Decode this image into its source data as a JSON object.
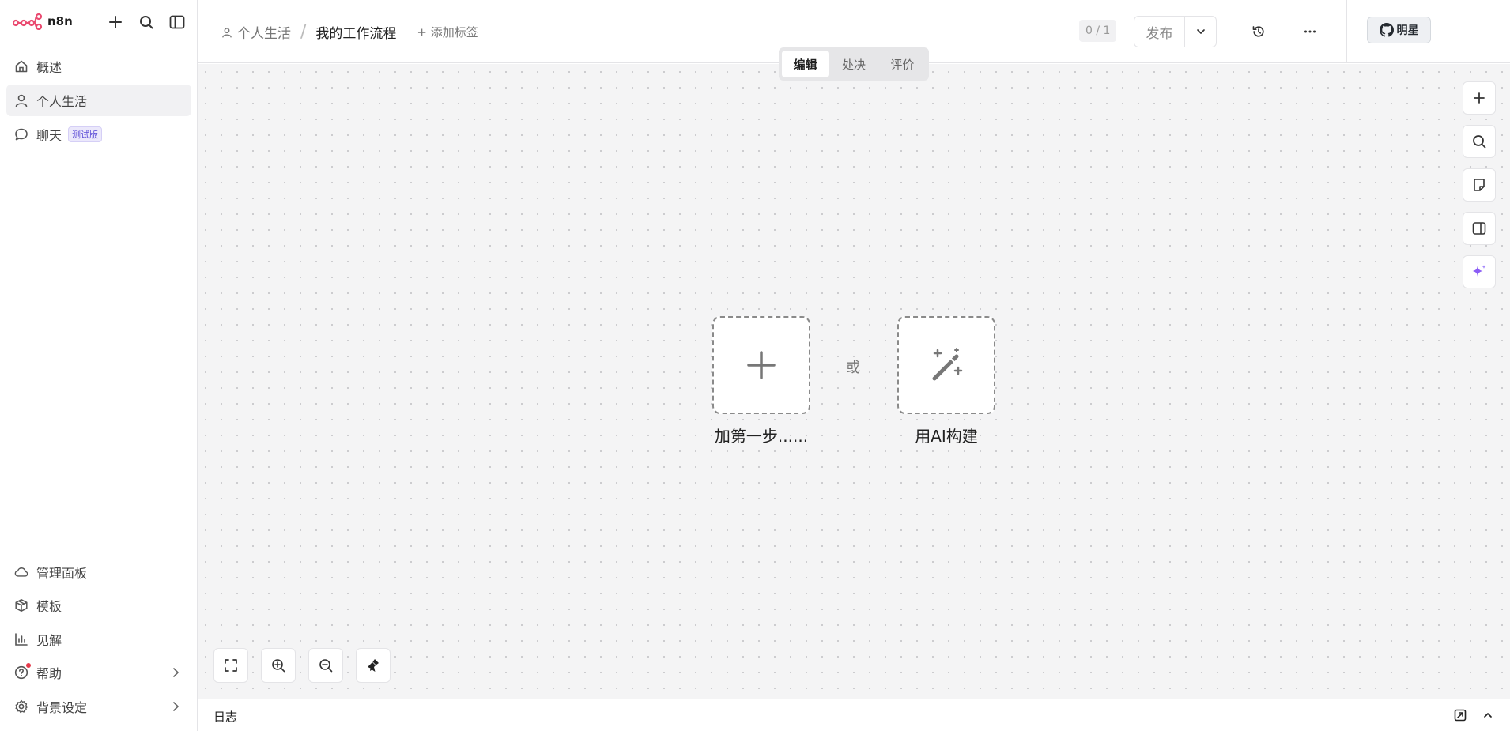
{
  "app": {
    "name": "n8n"
  },
  "sidebar": {
    "items": [
      {
        "label": "概述",
        "icon": "home-icon"
      },
      {
        "label": "个人生活",
        "icon": "user-icon"
      },
      {
        "label": "聊天",
        "icon": "chat-icon",
        "badge": "测试版"
      }
    ],
    "bottom_items": [
      {
        "label": "管理面板",
        "icon": "cloud-icon"
      },
      {
        "label": "模板",
        "icon": "box-icon"
      },
      {
        "label": "见解",
        "icon": "bar-chart-icon"
      },
      {
        "label": "帮助",
        "icon": "help-icon"
      },
      {
        "label": "背景设定",
        "icon": "gear-icon"
      }
    ]
  },
  "header": {
    "project": "个人生活",
    "separator": "/",
    "workflow_name": "我的工作流程",
    "add_tag": "+ 添加标签",
    "counter": "0 / 1",
    "publish_label": "发布",
    "star_label": "明星"
  },
  "mode_tabs": {
    "items": [
      "编辑",
      "处决",
      "评价"
    ],
    "active": "编辑"
  },
  "canvas": {
    "add_first_step": "加第一步......",
    "or": "或",
    "build_with_ai": "用AI构建"
  },
  "logs": {
    "label": "日志"
  },
  "colors": {
    "brand": "#ea4b71",
    "ai_accent": "#8b5cf6",
    "badge": "#5b4bd6"
  }
}
